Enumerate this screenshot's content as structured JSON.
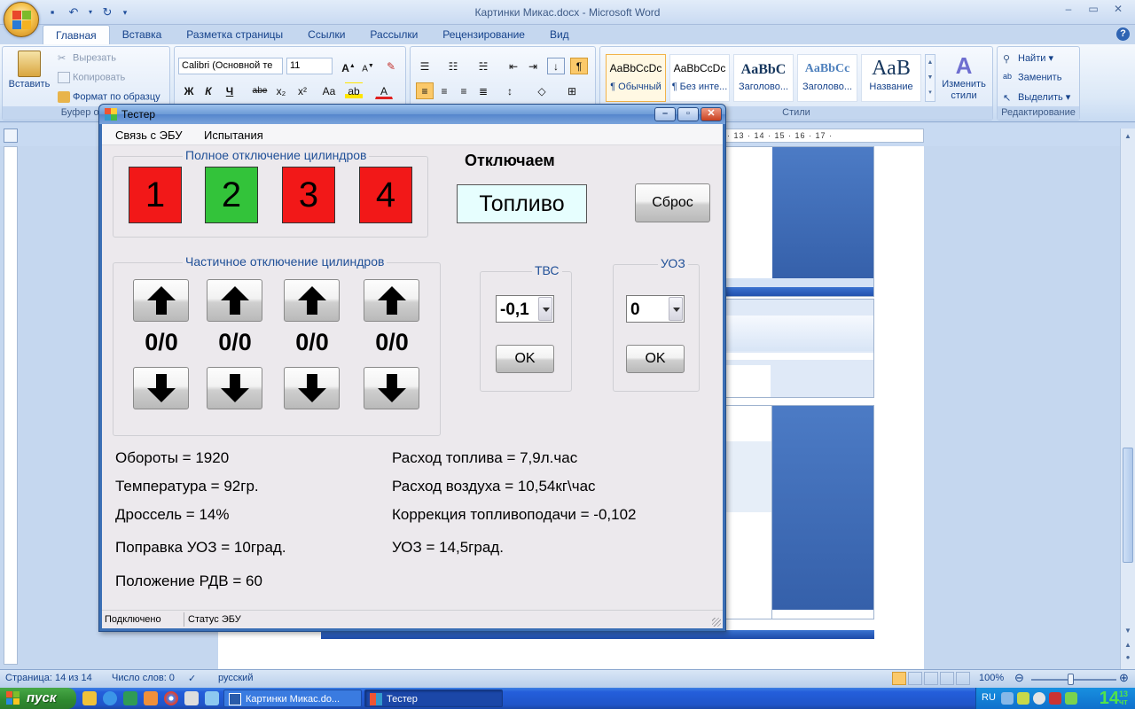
{
  "word": {
    "title": "Картинки Микас.docx - Microsoft Word",
    "tabs": [
      "Главная",
      "Вставка",
      "Разметка страницы",
      "Ссылки",
      "Рассылки",
      "Рецензирование",
      "Вид"
    ],
    "clipboard": {
      "paste": "Вставить",
      "cut": "Вырезать",
      "copy": "Копировать",
      "format_painter": "Формат по образцу",
      "group_label": "Буфер обм"
    },
    "font": {
      "family": "Calibri (Основной те",
      "size": "11",
      "bold": "Ж",
      "italic": "К",
      "underline": "Ч",
      "strike": "abe",
      "subscript": "x₂",
      "superscript": "x²",
      "case": "Aa",
      "grow": "A",
      "shrink": "A"
    },
    "styles": {
      "cards": [
        {
          "sample": "AaBbCcDc",
          "name": "¶ Обычный"
        },
        {
          "sample": "AaBbCcDc",
          "name": "¶ Без инте..."
        },
        {
          "sample": "AaBbC",
          "name": "Заголово..."
        },
        {
          "sample": "AaBbCc",
          "name": "Заголово..."
        },
        {
          "sample": "АаВ",
          "name": "Название"
        }
      ],
      "change_styles": "Изменить стили",
      "group_label": "Стили"
    },
    "editing": {
      "find": "Найти",
      "replace": "Заменить",
      "select": "Выделить",
      "group_label": "Редактирование"
    },
    "ruler_numbers": "· 13 · 14 · 15 · 16 · 17 ·",
    "status": {
      "page": "Страница: 14 из 14",
      "words": "Число слов: 0",
      "language": "русский",
      "zoom": "100%"
    },
    "accent": "#15428b"
  },
  "tester": {
    "title": "Тестер",
    "menu": [
      "Связь с ЭБУ",
      "Испытания"
    ],
    "full_cutoff": {
      "label": "Полное отключение цилиндров",
      "cylinders": [
        {
          "number": "1",
          "state": "off",
          "color": "#f21818"
        },
        {
          "number": "2",
          "state": "on",
          "color": "#33c33a"
        },
        {
          "number": "3",
          "state": "off",
          "color": "#f21818"
        },
        {
          "number": "4",
          "state": "off",
          "color": "#f21818"
        }
      ]
    },
    "disable": {
      "heading": "Отключаем",
      "value": "Топливо"
    },
    "reset_button": "Сброс",
    "partial_cutoff": {
      "label": "Частичное отключение цилиндров",
      "values": [
        "0/0",
        "0/0",
        "0/0",
        "0/0"
      ]
    },
    "tvs": {
      "label": "ТВС",
      "value": "-0,1",
      "ok": "OK"
    },
    "uoz": {
      "label": "УОЗ",
      "value": "0",
      "ok": "OK"
    },
    "params_left": [
      "Обороты = 1920",
      "Температура = 92гр.",
      "Дроссель = 14%",
      "Поправка УОЗ = 10град.",
      "Положение РДВ = 60"
    ],
    "params_right": [
      "Расход топлива = 7,9л.час",
      "Расход воздуха = 10,54кг\\час",
      "Коррекция топливоподачи = -0,102",
      "УОЗ = 14,5град."
    ],
    "status": {
      "connection": "Подключено",
      "ecu": "Статус ЭБУ"
    }
  },
  "taskbar": {
    "start": "пуск",
    "tasks": [
      "Картинки Микас.do...",
      "Тестер"
    ],
    "language": "RU",
    "clock": "14",
    "clock_small_top": "13",
    "clock_small_bottom": "чт"
  }
}
